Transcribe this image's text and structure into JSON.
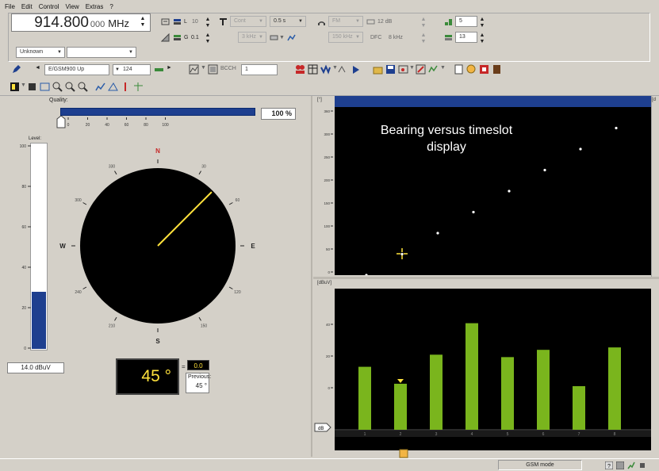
{
  "menu": [
    "File",
    "Edit",
    "Control",
    "View",
    "Extras",
    "?"
  ],
  "frequency": {
    "main": "914.800",
    "small": "000",
    "unit": "MHz"
  },
  "toolbar1": {
    "mode_combo": "Unknown",
    "combo2": "",
    "l_label": "L",
    "l_value": "10",
    "g_value": "0.1",
    "cont_combo": "Cont",
    "time_combo": "0.5 s",
    "demod_combo": "FM",
    "dB_label": "12 dB",
    "khz_combo": "3 kHz",
    "bw_combo": "150 kHz",
    "dfc_label": "DFC",
    "khz_small": "8 kHz",
    "right_val1": "5",
    "right_val2": "13"
  },
  "toolbar3": {
    "band_combo": "E/GSM900 Up",
    "channel_combo": "124",
    "bcch_label": "BCCH",
    "bcch_value": "1"
  },
  "quality": {
    "label": "Quality:",
    "percent": "100 %",
    "ticks": [
      "0",
      "20",
      "40",
      "60",
      "80",
      "100"
    ]
  },
  "level": {
    "label": "Level:",
    "value": "14.0 dBuV",
    "fill_fraction": 0.28,
    "ticks": [
      "100",
      "80",
      "60",
      "40",
      "20",
      "0"
    ]
  },
  "compass": {
    "N": "N",
    "E": "E",
    "S": "S",
    "W": "W",
    "degree_ticks": [
      "30",
      "60",
      "120",
      "150",
      "210",
      "240",
      "300",
      "330"
    ],
    "bearing_deg": 45
  },
  "bearing_display": {
    "value": "45 °",
    "small_eq": "=",
    "small_value": "0.0",
    "previous_label": "Previous:",
    "previous_value": "45 °"
  },
  "top_plot": {
    "caption": "Bearing versus timeslot display",
    "axis_label": "[°]",
    "y_ticks": [
      "360",
      "300",
      "250",
      "200",
      "150",
      "100",
      "50",
      "0"
    ],
    "cursor_color": "#ffe23c",
    "point_color": "#ffffff"
  },
  "chart_data": [
    {
      "type": "scatter",
      "title": "",
      "ylabel": "[°]",
      "ylim": [
        0,
        360
      ],
      "x": [
        1,
        2,
        3,
        4,
        5,
        6,
        7,
        8
      ],
      "y": [
        0,
        45,
        90,
        135,
        180,
        225,
        270,
        315
      ]
    },
    {
      "type": "bar",
      "title": "",
      "ylabel": "[dBuV]",
      "categories": [
        "1",
        "2",
        "3",
        "4",
        "5",
        "6",
        "7",
        "8"
      ],
      "values": [
        26,
        19,
        31,
        44,
        30,
        33,
        18,
        34
      ],
      "ylim": [
        0,
        55
      ],
      "y_ticks": [
        "40",
        "20",
        "0"
      ],
      "bar_color": "#7ab51d",
      "marker_slot": "2"
    }
  ],
  "bottom_plot": {
    "axis_label": "[dBuV]"
  },
  "status": {
    "mode": "GSM mode"
  }
}
